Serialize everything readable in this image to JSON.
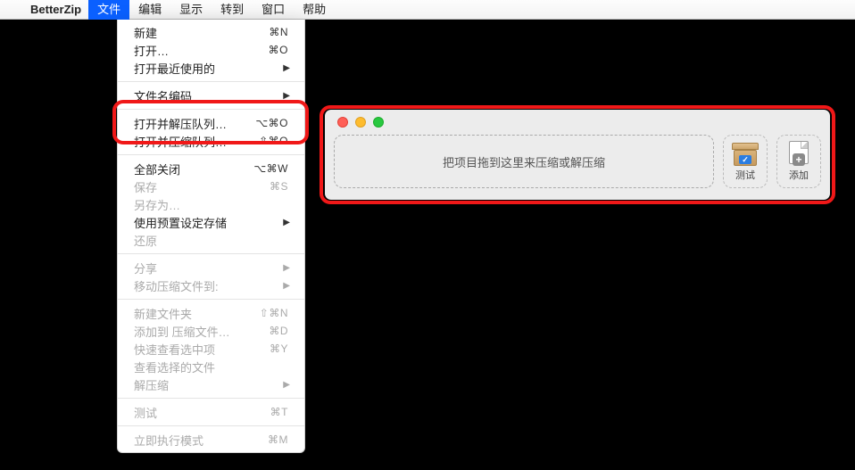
{
  "menubar": {
    "app": "BetterZip",
    "items": [
      "文件",
      "编辑",
      "显示",
      "转到",
      "窗口",
      "帮助"
    ],
    "active_index": 0
  },
  "dropdown": {
    "groups": [
      [
        {
          "label": "新建",
          "shortcut": "⌘N"
        },
        {
          "label": "打开…",
          "shortcut": "⌘O"
        },
        {
          "label": "打开最近使用的",
          "submenu": true
        }
      ],
      [
        {
          "label": "文件名编码",
          "submenu": true
        }
      ],
      [
        {
          "label": "打开并解压队列…",
          "shortcut": "⌥⌘O"
        },
        {
          "label": "打开并压缩队列…",
          "shortcut": "⇧⌘O"
        }
      ],
      [
        {
          "label": "全部关闭",
          "shortcut": "⌥⌘W"
        },
        {
          "label": "保存",
          "shortcut": "⌘S",
          "disabled": true
        },
        {
          "label": "另存为…",
          "disabled": true
        },
        {
          "label": "使用预置设定存储",
          "submenu": true
        },
        {
          "label": "还原",
          "disabled": true
        }
      ],
      [
        {
          "label": "分享",
          "submenu": true,
          "disabled": true
        },
        {
          "label": "移动压缩文件到:",
          "submenu": true,
          "disabled": true
        }
      ],
      [
        {
          "label": "新建文件夹",
          "shortcut": "⇧⌘N",
          "disabled": true
        },
        {
          "label": "添加到 压缩文件…",
          "shortcut": "⌘D",
          "disabled": true
        },
        {
          "label": "快速查看选中项",
          "shortcut": "⌘Y",
          "disabled": true
        },
        {
          "label": "查看选择的文件",
          "disabled": true
        },
        {
          "label": "解压缩",
          "submenu": true,
          "disabled": true
        }
      ],
      [
        {
          "label": "测试",
          "shortcut": "⌘T",
          "disabled": true
        }
      ],
      [
        {
          "label": "立即执行模式",
          "shortcut": "⌘M",
          "disabled": true
        }
      ]
    ]
  },
  "window": {
    "dropzone_text": "把项目拖到这里来压缩或解压缩",
    "tool_test": "测试",
    "tool_add": "添加"
  }
}
